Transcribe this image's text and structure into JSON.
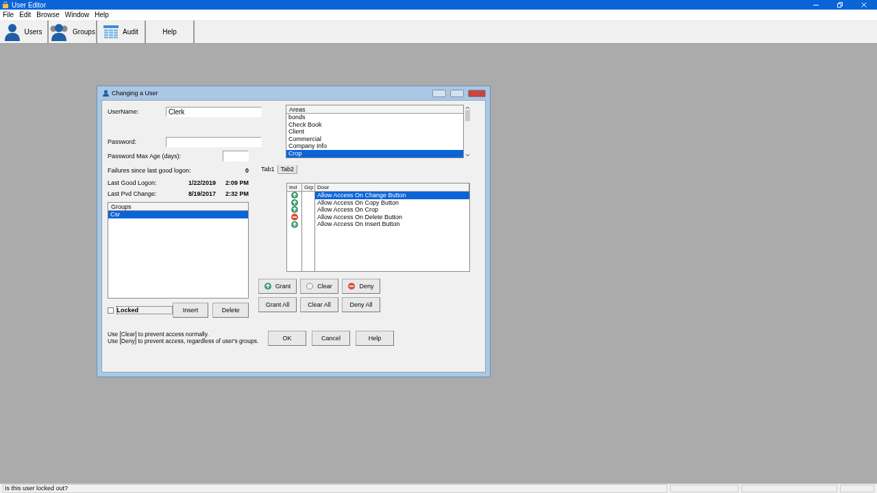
{
  "window": {
    "title": "User Editor"
  },
  "menu": [
    "File",
    "Edit",
    "Browse",
    "Window",
    "Help"
  ],
  "toolbar": [
    {
      "label": "Users",
      "kind": "user"
    },
    {
      "label": "Groups",
      "kind": "group"
    },
    {
      "label": "Audit",
      "kind": "table"
    },
    {
      "label": "Help",
      "kind": "none"
    }
  ],
  "dialog": {
    "title": "Changing a User",
    "username": {
      "label": "UserName:",
      "value": "Clerk"
    },
    "password": {
      "label": "Password:"
    },
    "max_age": {
      "label": "Password Max Age (days):"
    },
    "failures": {
      "label": "Failures since last good logon:",
      "value": "0"
    },
    "stats": [
      {
        "label": "Last Good Logon:",
        "date": "1/22/2019",
        "time": "2:09 PM"
      },
      {
        "label": "Last Pvd Change:",
        "date": "8/19/2017",
        "time": "2:32 PM"
      }
    ],
    "groups": {
      "header": "Groups",
      "items": [
        {
          "label": "Csr",
          "selected": true
        }
      ]
    },
    "locked": {
      "label": "Locked",
      "checked": false
    },
    "group_buttons": [
      "Insert",
      "Delete"
    ],
    "areas": {
      "header": "Areas",
      "items": [
        {
          "label": "bonds",
          "selected": false
        },
        {
          "label": "Check Book",
          "selected": false
        },
        {
          "label": "Client",
          "selected": false
        },
        {
          "label": "Commercial",
          "selected": false
        },
        {
          "label": "Company Info",
          "selected": false
        },
        {
          "label": "Crop",
          "selected": true
        }
      ]
    },
    "tabs": [
      {
        "label": "Tab1",
        "selected": true
      },
      {
        "label": "Tab2",
        "selected": false
      }
    ],
    "doors": {
      "columns": [
        "Ind",
        "Grp",
        "Door"
      ],
      "rows": [
        {
          "kind": "grant",
          "label": "Allow Access On Change Button",
          "selected": true
        },
        {
          "kind": "grant",
          "label": "Allow Access On Copy Button",
          "selected": false
        },
        {
          "kind": "grant",
          "label": "Allow Access On Crop",
          "selected": false
        },
        {
          "kind": "deny",
          "label": "Allow Access On Delete Button",
          "selected": false
        },
        {
          "kind": "grant",
          "label": "Allow Access On Insert Button",
          "selected": false
        }
      ]
    },
    "actions": [
      {
        "label": "Grant",
        "kind": "grant"
      },
      {
        "label": "Clear",
        "kind": "clear"
      },
      {
        "label": "Deny",
        "kind": "deny"
      }
    ],
    "all_actions": [
      "Grant All",
      "Clear All",
      "Deny All"
    ],
    "hints": [
      "Use [Clear] to prevent access normally.",
      "Use [Deny] to prevent access, regardless of user's groups."
    ],
    "buttons": [
      "OK",
      "Cancel",
      "Help"
    ]
  },
  "status_bar": "Is this user locked out?"
}
